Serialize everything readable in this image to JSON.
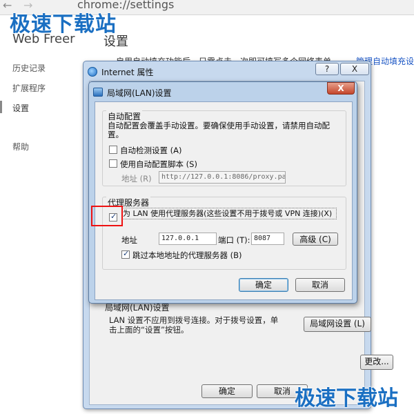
{
  "browser": {
    "url": "chrome://settings",
    "back_glyph": "←",
    "forward_glyph": "→"
  },
  "watermark": {
    "text": "极速下载站"
  },
  "settings_page": {
    "brand": "Web Freer",
    "title": "设置",
    "sidebar": [
      {
        "label": "历史记录"
      },
      {
        "label": "扩展程序"
      },
      {
        "label": "设置"
      },
      {
        "label": "帮助"
      }
    ],
    "autofill_text": "启用自动填充功能后，只需点击一次即可填写多个网络表单。",
    "autofill_link": "管理自动填充设"
  },
  "inet_window": {
    "title": "Internet 属性",
    "help_label": "?",
    "close_label": "X",
    "lan_section_title": "局域网(LAN)设置",
    "lan_desc": "LAN 设置不应用到拨号连接。对于拨号设置，单击上面的“设置”按钮。",
    "lan_settings_button": "局域网设置 (L)",
    "change_button": "更改...",
    "ok_button": "确定",
    "cancel_button": "取消"
  },
  "lan_dialog": {
    "title": "局域网(LAN)设置",
    "close_label": "X",
    "auto_config": {
      "label": "自动配置",
      "desc": "自动配置会覆盖手动设置。要确保使用手动设置，请禁用自动配置。",
      "detect_label": "自动检测设置 (A)",
      "detect_checked": false,
      "script_label": "使用自动配置脚本 (S)",
      "script_checked": false,
      "address_label": "地址 (R)",
      "address_value": "http://127.0.0.1:8086/proxy.pa"
    },
    "proxy": {
      "label": "代理服务器",
      "use_proxy_label": "为 LAN 使用代理服务器(这些设置不用于拨号或 VPN 连接)(X)",
      "use_proxy_checked": true,
      "address_label": "地址",
      "address_value": "127.0.0.1",
      "port_label": "端口 (T):",
      "port_value": "8087",
      "advanced_button": "高级 (C)",
      "bypass_label": "跳过本地地址的代理服务器 (B)",
      "bypass_checked": true
    },
    "ok_button": "确定",
    "cancel_button": "取消"
  },
  "colors": {
    "watermark": "#1a6fc2",
    "highlight": "#ee1111",
    "link": "#1a55c4"
  }
}
